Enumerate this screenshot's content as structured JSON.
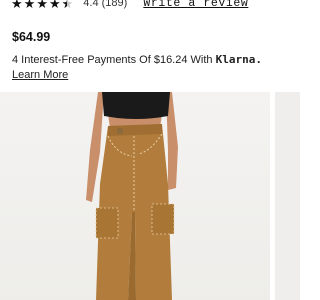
{
  "rating": {
    "stars": 4.4,
    "score_text": "4.4",
    "count_text": "(189)",
    "write_review_label": "Write a review",
    "icon": "star-icon"
  },
  "price": "$64.99",
  "financing": {
    "text": "4 Interest-Free Payments Of $16.24 With",
    "provider": "Klarna.",
    "learn_more_label": "Learn More"
  },
  "gallery": {
    "colors": {
      "pants": "#b27d3c",
      "top": "#1a1a1a",
      "skin": "#c98f6a"
    }
  }
}
